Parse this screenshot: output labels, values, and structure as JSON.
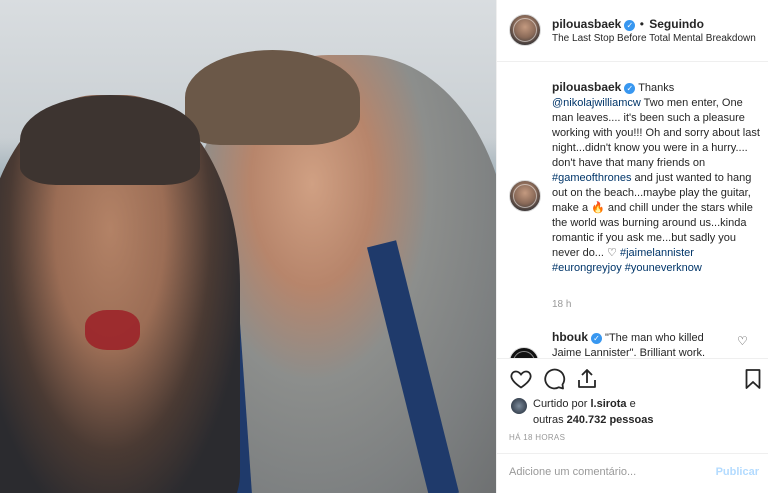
{
  "post": {
    "username": "pilouasbaek",
    "separator": "•",
    "follow_status": "Seguindo",
    "location": "The Last Stop Before Total Mental Breakdown"
  },
  "caption": {
    "username": "pilouasbaek",
    "text_1": " Thanks ",
    "mention": "@nikolajwilliamcw",
    "text_2": " Two men enter, One man leaves.... it's been such a pleasure working with you!!! Oh and sorry about last night...didn't know you were in a hurry.... don't have that many friends on ",
    "tag_got": "#gameofthrones",
    "text_3": " and just wanted to hang out on the beach...maybe play the guitar, make a ",
    "fire_emoji": "🔥",
    "text_4": " and chill under the stars while the world was burning around us...kinda romantic if you ask me...but sadly you never do... ",
    "heart_emoji": "♡",
    "text_5": " ",
    "tag_jaime": "#jaimelannister",
    "tag_euron": "#eurongreyjoy",
    "tag_you": "#youneverknow",
    "time": "18 h"
  },
  "comment": {
    "username": "hbouk",
    "text": " \"The man who killed Jaime Lannister\". Brilliant work."
  },
  "likes": {
    "prefix": "Curtido por ",
    "user": "l.sirota",
    "mid": " e",
    "line2_prefix": "outras ",
    "count": "240.732 pessoas"
  },
  "timestamp": "HÁ 18 HORAS",
  "add_comment": {
    "placeholder": "Adicione um comentário...",
    "publish": "Publicar"
  },
  "colors": {
    "verified": "#3897f0",
    "hashtag": "#003569",
    "publish_disabled": "#b3dbff"
  },
  "icons": {
    "like": "heart-icon",
    "comment": "comment-icon",
    "share": "share-icon",
    "save": "bookmark-icon"
  }
}
